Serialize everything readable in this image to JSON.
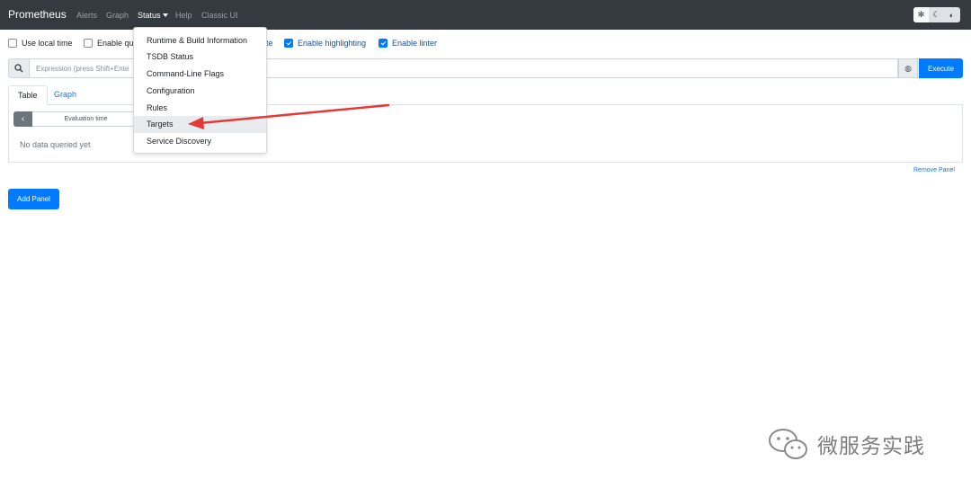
{
  "navbar": {
    "brand": "Prometheus",
    "links": [
      "Alerts",
      "Graph",
      "Status",
      "Help",
      "Classic UI"
    ],
    "theme_buttons": [
      "sun-icon",
      "moon-icon",
      "half-circle-icon"
    ]
  },
  "options": {
    "use_local_time": "Use local time",
    "enable_query_history": "Enable que",
    "enable_autocomplete_tail": "te",
    "enable_highlighting": "Enable highlighting",
    "enable_linter": "Enable linter"
  },
  "expression": {
    "placeholder": "Expression (press Shift+Ente",
    "execute_label": "Execute"
  },
  "tabs": [
    "Table",
    "Graph"
  ],
  "panel": {
    "eval_time_placeholder": "Evaluation time",
    "no_data": "No data queried yet",
    "remove_label": "Remove Panel"
  },
  "add_panel_label": "Add Panel",
  "status_menu": {
    "items": [
      "Runtime & Build Information",
      "TSDB Status",
      "Command-Line Flags",
      "Configuration",
      "Rules",
      "Targets",
      "Service Discovery"
    ],
    "highlighted": "Targets"
  },
  "watermark": {
    "text": "微服务实践"
  },
  "colors": {
    "navbar": "#343a40",
    "accent": "#007bff",
    "arrow": "#e53935"
  }
}
